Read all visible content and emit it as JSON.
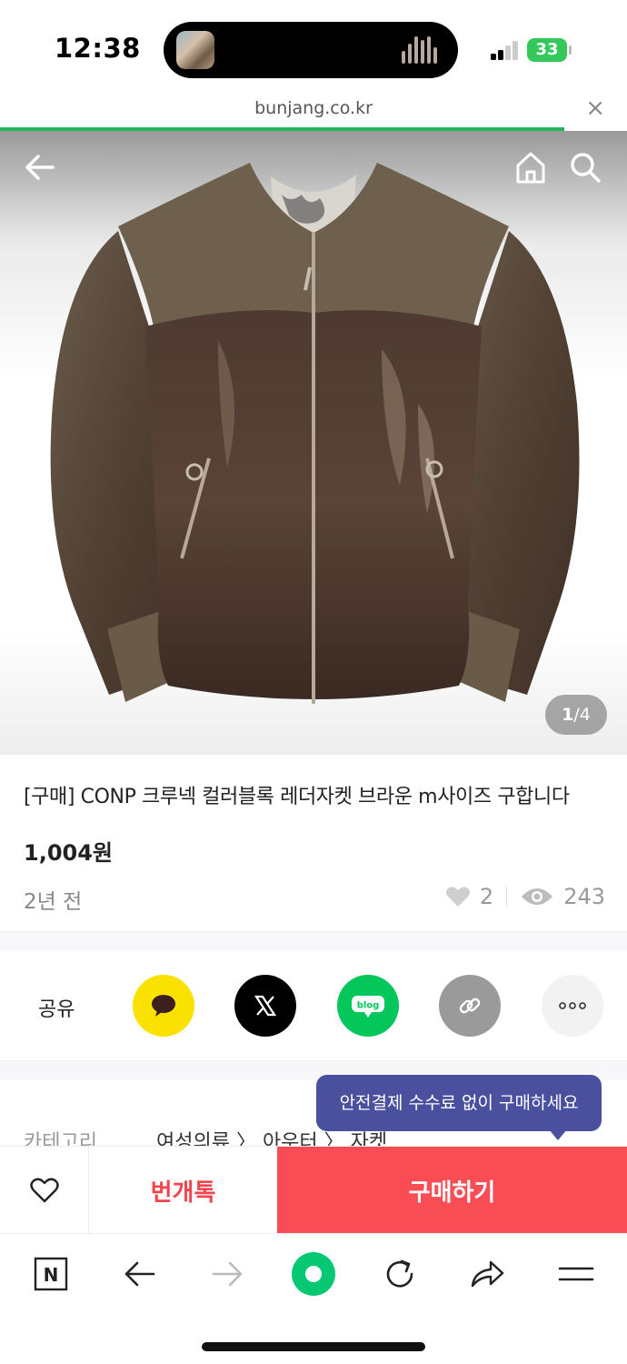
{
  "status": {
    "time": "12:38",
    "battery": "33"
  },
  "browser": {
    "url": "bunjang.co.kr",
    "close": "×",
    "load_progress": 0.9
  },
  "hero": {
    "counter_current": "1",
    "counter_sep": "/",
    "counter_total": "4"
  },
  "product": {
    "title": "[구매] CONP 크루넥 컬러블록 레더자켓 브라운 m사이즈 구합니다",
    "price": "1,004원",
    "time_ago": "2년 전",
    "likes": "2",
    "views": "243"
  },
  "share": {
    "label": "공유",
    "blog_text": "blog",
    "buttons": [
      {
        "name": "kakaotalk",
        "color": "#fae100"
      },
      {
        "name": "x",
        "color": "#000000"
      },
      {
        "name": "naver-blog",
        "color": "#03c75a"
      },
      {
        "name": "link",
        "color": "#9a9a9a"
      },
      {
        "name": "more",
        "color": "#f2f2f2"
      }
    ]
  },
  "category": {
    "label": "카테고리",
    "path": "여성의류 〉 아우터 〉 자켓"
  },
  "tooltip": {
    "text": "안전결제 수수료 없이 구매하세요"
  },
  "actions": {
    "talk_label": "번개톡",
    "buy_label": "구매하기",
    "buy_color": "#f84d55"
  },
  "toolbar": {
    "naver_label": "N",
    "icons": [
      "naver-icon",
      "back-icon",
      "forward-icon",
      "green-dot-icon",
      "reload-icon",
      "share-icon",
      "menu-icon"
    ]
  }
}
